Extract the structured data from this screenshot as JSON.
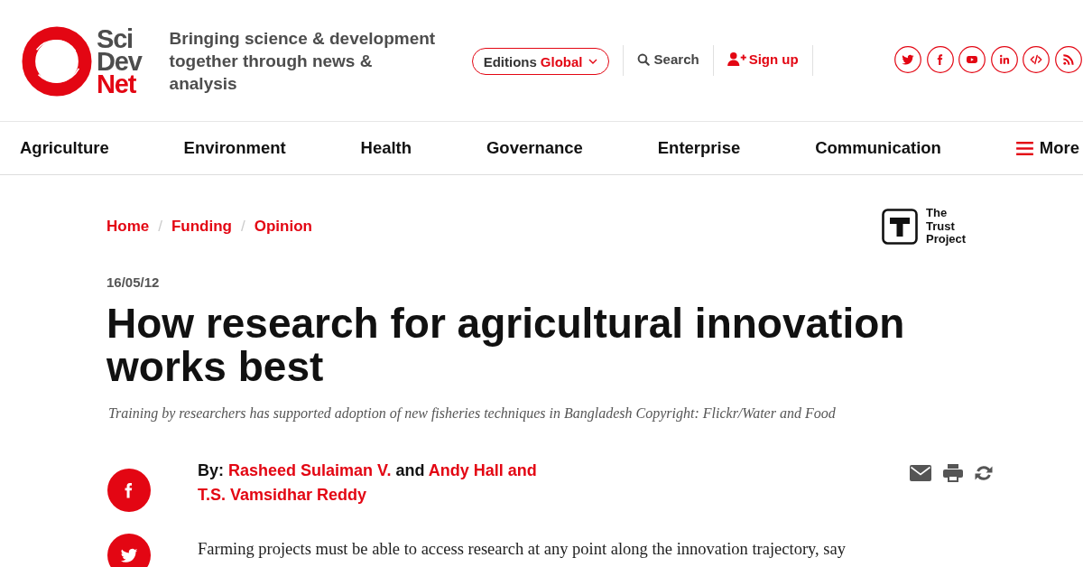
{
  "header": {
    "logo": {
      "words": [
        "Sci",
        "Dev",
        "Net"
      ]
    },
    "tagline": "Bringing science & development together through news & analysis",
    "editions": {
      "label": "Editions",
      "value": "Global"
    },
    "search": "Search",
    "sign_up": "Sign up",
    "social_links": [
      {
        "kind": "twitter"
      },
      {
        "kind": "facebook"
      },
      {
        "kind": "youtube"
      },
      {
        "kind": "linkedin"
      },
      {
        "kind": "embed"
      },
      {
        "kind": "rss"
      }
    ]
  },
  "nav": {
    "items": [
      "Agriculture",
      "Environment",
      "Health",
      "Governance",
      "Enterprise",
      "Communication"
    ],
    "more": "More"
  },
  "breadcrumb": {
    "items": [
      "Home",
      "Funding",
      "Opinion"
    ],
    "separators": [
      "/",
      "/"
    ]
  },
  "trust_badge": {
    "text": "The Trust Project"
  },
  "article": {
    "date": "16/05/12",
    "title": "How research for agricultural innovation works best",
    "caption": "Training by researchers has supported adoption of new fisheries techniques in Bangladesh Copyright: Flickr/Water and Food",
    "share": [
      {
        "kind": "facebook"
      },
      {
        "kind": "twitter"
      }
    ],
    "byline": {
      "label": "By:",
      "parts": [
        {
          "kind": "author",
          "text": "Rasheed Sulaiman V."
        },
        {
          "kind": "text",
          "text": "and"
        },
        {
          "kind": "author",
          "text": "Andy Hall and"
        },
        {
          "kind": "author",
          "text": "T.S. Vamsidhar Reddy"
        }
      ]
    },
    "tools": [
      {
        "kind": "email"
      },
      {
        "kind": "print"
      },
      {
        "kind": "refresh"
      }
    ],
    "body": "Farming projects must be able to access research at any point along the innovation trajectory, say"
  }
}
